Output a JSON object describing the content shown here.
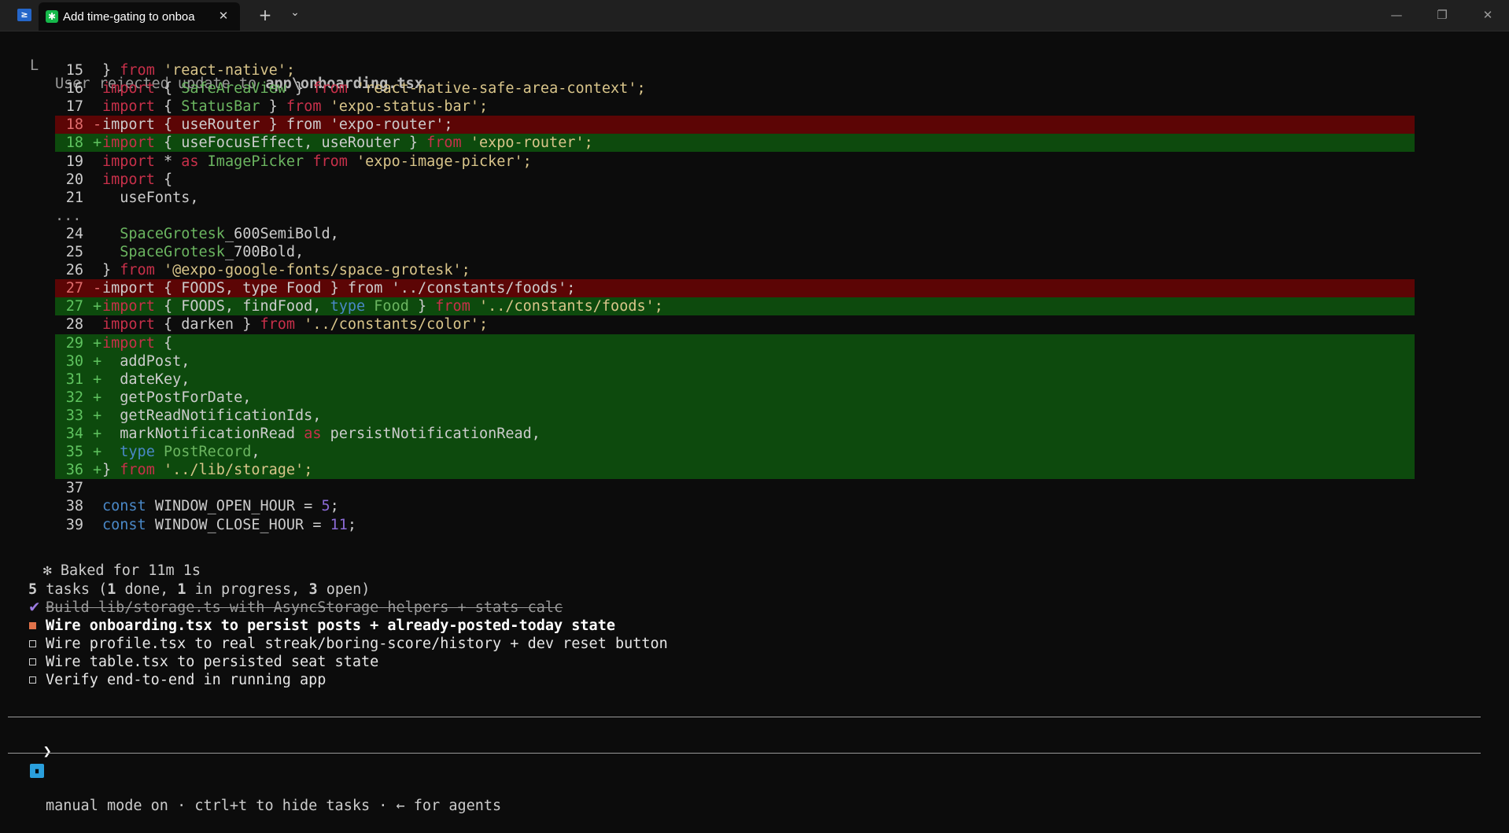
{
  "window": {
    "tab_title": "Add time-gating to onboa",
    "tab_close": "✕",
    "new_tab": "+",
    "dropdown": "⌄",
    "minimize": "—",
    "restore": "❐",
    "close": "✕",
    "terminal_icon": "≥",
    "tab_icon": "✱"
  },
  "tool_result": {
    "marker": "L",
    "text_prefix": "User rejected update to ",
    "file": "app\\onboarding.tsx"
  },
  "diff": [
    {
      "n": "15",
      "m": "",
      "k": "ctx",
      "t": [
        [
          "} ",
          "plain"
        ],
        [
          "from",
          "kw"
        ],
        [
          " 'react-native';",
          "str"
        ]
      ]
    },
    {
      "n": "16",
      "m": "",
      "k": "ctx",
      "t": [
        [
          "import",
          "kw"
        ],
        [
          " { ",
          "plain"
        ],
        [
          "SafeAreaView",
          "typ"
        ],
        [
          " } ",
          "plain"
        ],
        [
          "from",
          "kw"
        ],
        [
          " 'react-native-safe-area-context';",
          "str"
        ]
      ]
    },
    {
      "n": "17",
      "m": "",
      "k": "ctx",
      "t": [
        [
          "import",
          "kw"
        ],
        [
          " { ",
          "plain"
        ],
        [
          "StatusBar",
          "typ"
        ],
        [
          " } ",
          "plain"
        ],
        [
          "from",
          "kw"
        ],
        [
          " 'expo-status-bar';",
          "str"
        ]
      ]
    },
    {
      "n": "18",
      "m": "-",
      "k": "del",
      "t": [
        [
          "import { useRouter } from 'expo-router';",
          "plain"
        ]
      ]
    },
    {
      "n": "18",
      "m": "+",
      "k": "add",
      "t": [
        [
          "import",
          "kw"
        ],
        [
          " { useFocusEffect, useRouter } ",
          "plain"
        ],
        [
          "from",
          "kw"
        ],
        [
          " 'expo-router';",
          "str"
        ]
      ]
    },
    {
      "n": "19",
      "m": "",
      "k": "ctx",
      "t": [
        [
          "import",
          "kw"
        ],
        [
          " * ",
          "plain"
        ],
        [
          "as",
          "kw"
        ],
        [
          " ImagePicker ",
          "typ"
        ],
        [
          "from",
          "kw"
        ],
        [
          " 'expo-image-picker';",
          "str"
        ]
      ]
    },
    {
      "n": "20",
      "m": "",
      "k": "ctx",
      "t": [
        [
          "import",
          "kw"
        ],
        [
          " {",
          "plain"
        ]
      ]
    },
    {
      "n": "21",
      "m": "",
      "k": "ctx",
      "t": [
        [
          "  useFonts,",
          "plain"
        ]
      ]
    },
    {
      "n": "...",
      "m": "",
      "k": "gap",
      "t": []
    },
    {
      "n": "24",
      "m": "",
      "k": "ctx",
      "t": [
        [
          "  SpaceGrotesk",
          "typ"
        ],
        [
          "_600SemiBold,",
          "plain"
        ]
      ]
    },
    {
      "n": "25",
      "m": "",
      "k": "ctx",
      "t": [
        [
          "  SpaceGrotesk",
          "typ"
        ],
        [
          "_700Bold,",
          "plain"
        ]
      ]
    },
    {
      "n": "26",
      "m": "",
      "k": "ctx",
      "t": [
        [
          "} ",
          "plain"
        ],
        [
          "from",
          "kw"
        ],
        [
          " '@expo-google-fonts/space-grotesk';",
          "str"
        ]
      ]
    },
    {
      "n": "27",
      "m": "-",
      "k": "del",
      "t": [
        [
          "import { FOODS, type Food } from '../constants/foods';",
          "plain"
        ]
      ]
    },
    {
      "n": "27",
      "m": "+",
      "k": "add",
      "t": [
        [
          "import",
          "kw"
        ],
        [
          " { FOODS, findFood, ",
          "plain"
        ],
        [
          "type",
          "kw2"
        ],
        [
          " Food",
          "typ"
        ],
        [
          " } ",
          "plain"
        ],
        [
          "from",
          "kw"
        ],
        [
          " '../constants/foods';",
          "str"
        ]
      ]
    },
    {
      "n": "28",
      "m": "",
      "k": "ctx",
      "t": [
        [
          "import",
          "kw"
        ],
        [
          " { darken } ",
          "plain"
        ],
        [
          "from",
          "kw"
        ],
        [
          " '../constants/color';",
          "str"
        ]
      ]
    },
    {
      "n": "29",
      "m": "+",
      "k": "add",
      "t": [
        [
          "import",
          "kw"
        ],
        [
          " {",
          "plain"
        ]
      ]
    },
    {
      "n": "30",
      "m": "+",
      "k": "add",
      "t": [
        [
          "  addPost,",
          "plain"
        ]
      ]
    },
    {
      "n": "31",
      "m": "+",
      "k": "add",
      "t": [
        [
          "  dateKey,",
          "plain"
        ]
      ]
    },
    {
      "n": "32",
      "m": "+",
      "k": "add",
      "t": [
        [
          "  getPostForDate,",
          "plain"
        ]
      ]
    },
    {
      "n": "33",
      "m": "+",
      "k": "add",
      "t": [
        [
          "  getReadNotificationIds,",
          "plain"
        ]
      ]
    },
    {
      "n": "34",
      "m": "+",
      "k": "add",
      "t": [
        [
          "  markNotificationRead ",
          "plain"
        ],
        [
          "as",
          "kw"
        ],
        [
          " persistNotificationRead,",
          "plain"
        ]
      ]
    },
    {
      "n": "35",
      "m": "+",
      "k": "add",
      "t": [
        [
          "  ",
          "plain"
        ],
        [
          "type",
          "kw2"
        ],
        [
          " PostRecord",
          "typ"
        ],
        [
          ",",
          "plain"
        ]
      ]
    },
    {
      "n": "36",
      "m": "+",
      "k": "add",
      "t": [
        [
          "} ",
          "plain"
        ],
        [
          "from",
          "kw"
        ],
        [
          " '../lib/storage';",
          "str"
        ]
      ]
    },
    {
      "n": "37",
      "m": "",
      "k": "ctx",
      "t": []
    },
    {
      "n": "38",
      "m": "",
      "k": "ctx",
      "t": [
        [
          "const",
          "kw2"
        ],
        [
          " WINDOW_OPEN_HOUR = ",
          "plain"
        ],
        [
          "5",
          "num"
        ],
        [
          ";",
          "plain"
        ]
      ]
    },
    {
      "n": "39",
      "m": "",
      "k": "ctx",
      "t": [
        [
          "const",
          "kw2"
        ],
        [
          " WINDOW_CLOSE_HOUR = ",
          "plain"
        ],
        [
          "11",
          "num"
        ],
        [
          ";",
          "plain"
        ]
      ]
    }
  ],
  "status": {
    "glyph": "✻",
    "text": "Baked for 11m 1s"
  },
  "tasks": {
    "count": "5",
    "label": " tasks (",
    "done_count": "1",
    "done_label": " done, ",
    "progress_count": "1",
    "progress_label": " in progress, ",
    "open_count": "3",
    "open_label": " open)",
    "items": [
      {
        "state": "done",
        "text": "Build lib/storage.ts with AsyncStorage helpers + stats calc"
      },
      {
        "state": "progress",
        "text": "Wire onboarding.tsx to persist posts + already-posted-today state"
      },
      {
        "state": "open",
        "text": "Wire profile.tsx to real streak/boring-score/history + dev reset button"
      },
      {
        "state": "open",
        "text": "Wire table.tsx to persisted seat state"
      },
      {
        "state": "open",
        "text": "Verify end-to-end in running app"
      }
    ]
  },
  "prompt": {
    "symbol": "❯",
    "value": ""
  },
  "footer": {
    "mode_icon": "⏸",
    "text": "manual mode on · ctrl+t to hide tasks · ← for agents"
  }
}
